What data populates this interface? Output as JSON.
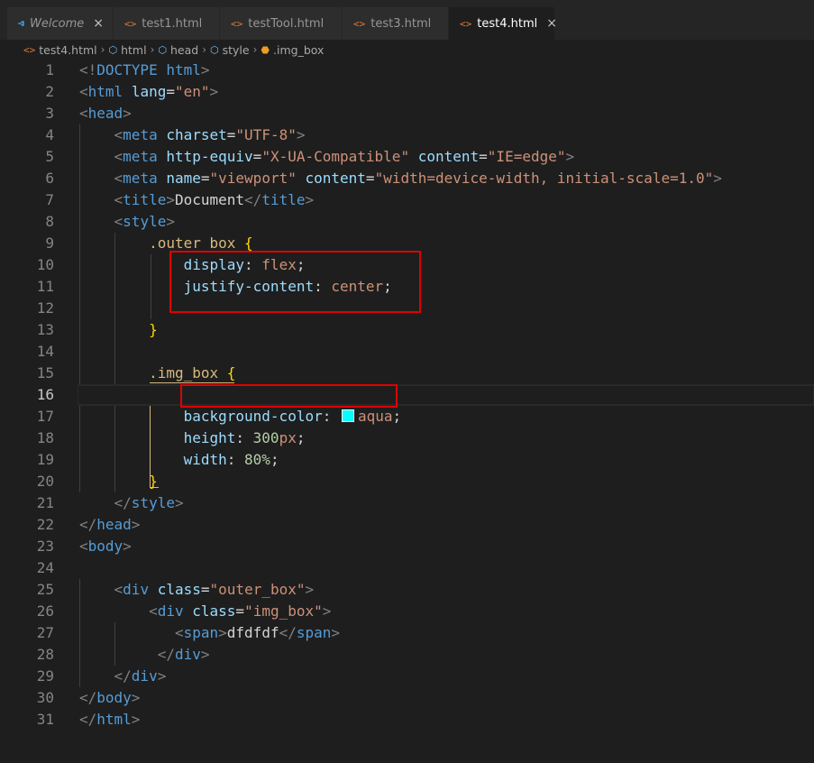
{
  "tabs": [
    {
      "label": "Welcome",
      "italic": true,
      "icon": "vscode-icon",
      "close": "×",
      "active": false
    },
    {
      "label": "test1.html",
      "icon": "html-icon",
      "active": false
    },
    {
      "label": "testTool.html",
      "icon": "html-icon",
      "active": false
    },
    {
      "label": "test3.html",
      "icon": "html-icon",
      "active": false
    },
    {
      "label": "test4.html",
      "icon": "html-icon",
      "close": "×",
      "active": true
    }
  ],
  "breadcrumb": {
    "file": "test4.html",
    "items": [
      "html",
      "head",
      "style",
      ".img_box"
    ]
  },
  "icons": {
    "html": "<>",
    "separator": "›"
  },
  "colors": {
    "swatch": "#00ffff",
    "annotation": "#e00000"
  },
  "editor": {
    "current_line": 16,
    "lines": [
      {
        "n": "1",
        "code": "<!DOCTYPE html>"
      },
      {
        "n": "2",
        "code": "<html lang=\"en\">"
      },
      {
        "n": "3",
        "code": "<head>"
      },
      {
        "n": "4",
        "code": "    <meta charset=\"UTF-8\">"
      },
      {
        "n": "5",
        "code": "    <meta http-equiv=\"X-UA-Compatible\" content=\"IE=edge\">"
      },
      {
        "n": "6",
        "code": "    <meta name=\"viewport\" content=\"width=device-width, initial-scale=1.0\">"
      },
      {
        "n": "7",
        "code": "    <title>Document</title>"
      },
      {
        "n": "8",
        "code": "    <style>"
      },
      {
        "n": "9",
        "code": "        .outer box {"
      },
      {
        "n": "10",
        "code": "            display: flex;"
      },
      {
        "n": "11",
        "code": "            justify-content: center;"
      },
      {
        "n": "12",
        "code": ""
      },
      {
        "n": "13",
        "code": "        }"
      },
      {
        "n": "14",
        "code": ""
      },
      {
        "n": "15",
        "code": "        .img_box {"
      },
      {
        "n": "16",
        "code": ""
      },
      {
        "n": "17",
        "code": "            background-color: aqua;"
      },
      {
        "n": "18",
        "code": "            height: 300px;"
      },
      {
        "n": "19",
        "code": "            width: 80%;"
      },
      {
        "n": "20",
        "code": "        }"
      },
      {
        "n": "21",
        "code": "    </style>"
      },
      {
        "n": "22",
        "code": "</head>"
      },
      {
        "n": "23",
        "code": "<body>"
      },
      {
        "n": "24",
        "code": ""
      },
      {
        "n": "25",
        "code": "    <div class=\"outer_box\">"
      },
      {
        "n": "26",
        "code": "        <div class=\"img_box\">"
      },
      {
        "n": "27",
        "code": "           <span>dfdfdf</span>"
      },
      {
        "n": "28",
        "code": "         </div>"
      },
      {
        "n": "29",
        "code": "    </div>"
      },
      {
        "n": "30",
        "code": "</body>"
      },
      {
        "n": "31",
        "code": "</html>"
      }
    ]
  }
}
